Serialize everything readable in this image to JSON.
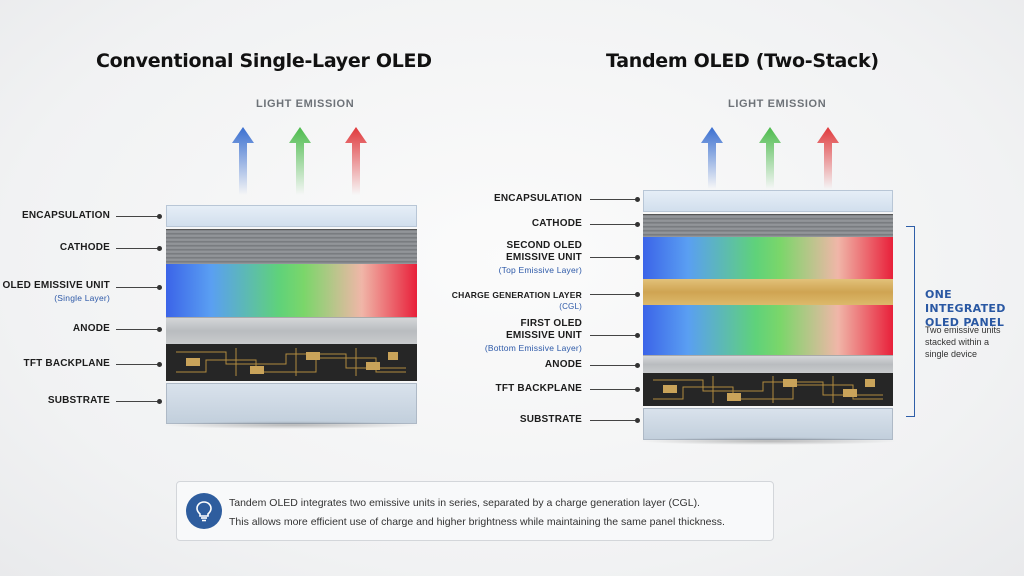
{
  "left": {
    "title": "Conventional Single-Layer OLED",
    "emission_label": "LIGHT EMISSION",
    "layers": {
      "encapsulation": "ENCAPSULATION",
      "cathode": "CATHODE",
      "emissive": "OLED EMISSIVE UNIT",
      "emissive_sub": "(Single Layer)",
      "anode": "ANODE",
      "tft": "TFT BACKPLANE",
      "substrate": "SUBSTRATE"
    }
  },
  "right": {
    "title": "Tandem OLED (Two-Stack)",
    "emission_label": "LIGHT EMISSION",
    "layers": {
      "encapsulation": "ENCAPSULATION",
      "cathode": "CATHODE",
      "second_line1": "SECOND OLED",
      "second_line2": "EMISSIVE UNIT",
      "second_sub": "(Top Emissive Layer)",
      "cgl": "CHARGE GENERATION LAYER",
      "cgl_sub": "(CGL)",
      "first_line1": "FIRST OLED",
      "first_line2": "EMISSIVE UNIT",
      "first_sub": "(Bottom Emissive Layer)",
      "anode": "ANODE",
      "tft": "TFT BACKPLANE",
      "substrate": "SUBSTRATE"
    },
    "panel": {
      "title_line1": "ONE INTEGRATED",
      "title_line2": "OLED PANEL",
      "note_line1": "Two emissive units",
      "note_line2": "stacked within a",
      "note_line3": "single device"
    }
  },
  "arrow_colors": {
    "blue": "#3a6fd0",
    "green": "#4cbb4c",
    "red": "#e0393c"
  },
  "note": {
    "icon": "lightbulb-icon",
    "line1": "Tandem OLED integrates two emissive units in series, separated by a charge generation layer (CGL).",
    "line2": "This allows more efficient use of charge and higher brightness while maintaining the same panel thickness."
  }
}
